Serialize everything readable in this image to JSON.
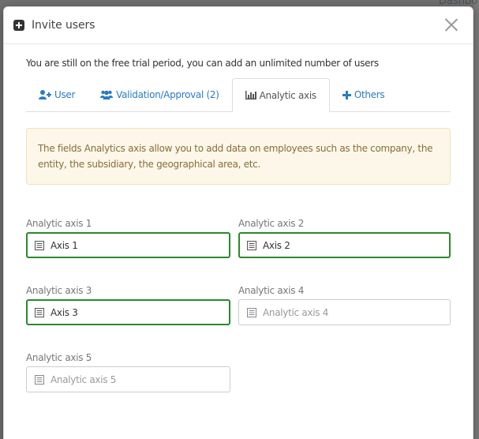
{
  "background": {
    "corner_text": "Dashbo"
  },
  "modal": {
    "title": "Invite users",
    "trial_notice": "You are still on the free trial period, you can add an unlimited number of users"
  },
  "tabs": [
    {
      "label": "User",
      "icon": "user-plus-icon",
      "active": false
    },
    {
      "label": "Validation/Approval (2)",
      "icon": "users-icon",
      "active": false
    },
    {
      "label": "Analytic axis",
      "icon": "bar-chart-icon",
      "active": true
    },
    {
      "label": "Others",
      "icon": "plus-icon",
      "active": false
    }
  ],
  "alert": {
    "text": "The fields Analytics axis allow you to add data on employees such as the company, the entity, the subsidiary, the geographical area, etc."
  },
  "fields": [
    {
      "label": "Analytic axis 1",
      "value": "Axis 1",
      "placeholder": "Analytic axis 1"
    },
    {
      "label": "Analytic axis 2",
      "value": "Axis 2",
      "placeholder": "Analytic axis 2"
    },
    {
      "label": "Analytic axis 3",
      "value": "Axis 3",
      "placeholder": "Analytic axis 3"
    },
    {
      "label": "Analytic axis 4",
      "value": "",
      "placeholder": "Analytic axis 4"
    },
    {
      "label": "Analytic axis 5",
      "value": "",
      "placeholder": "Analytic axis 5"
    }
  ],
  "colors": {
    "link": "#2a7bc5",
    "valid_border": "#2a8a2a",
    "alert_bg": "#fcf7e8",
    "alert_text": "#8a6d3b"
  }
}
